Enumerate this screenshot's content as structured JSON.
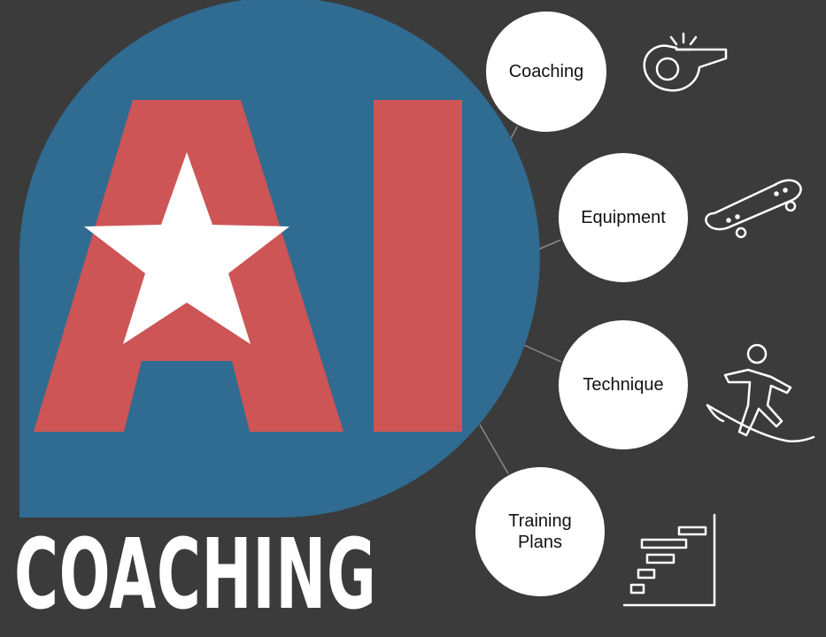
{
  "logo": {
    "letters": "AI",
    "wordmark": "COACHING"
  },
  "colors": {
    "background": "#3b3b3b",
    "blob_blue": "#306b91",
    "letter_red": "#cd5555",
    "star_white": "#ffffff",
    "node_fill": "#ffffff",
    "connector": "#8a8a8a"
  },
  "nodes": [
    {
      "label": "Coaching",
      "icon": "whistle-icon"
    },
    {
      "label": "Equipment",
      "icon": "skateboard-icon"
    },
    {
      "label": "Technique",
      "icon": "surfer-icon"
    },
    {
      "label": "Training\nPlans",
      "icon": "stairs-chart-icon"
    }
  ]
}
